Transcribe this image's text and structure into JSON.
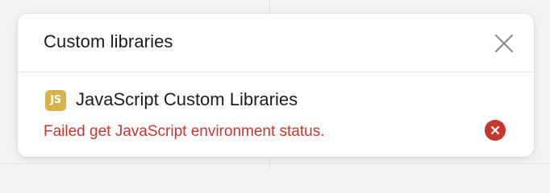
{
  "dialog": {
    "title": "Custom libraries",
    "close_icon": "close-icon"
  },
  "library": {
    "badge": "JS",
    "name": "JavaScript Custom Libraries",
    "error_message": "Failed get JavaScript environment status.",
    "status_icon": "error-circle-icon"
  },
  "colors": {
    "badge": "#d9b349",
    "error": "#c8352e",
    "title_text": "#1d1d1d",
    "close_icon": "#8a8a8a"
  }
}
